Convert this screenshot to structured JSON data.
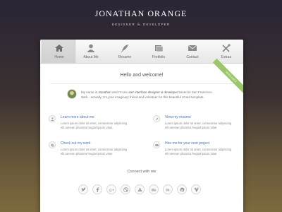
{
  "header": {
    "title": "JONATHAN ORANGE",
    "role1": "DESIGNER",
    "amp": "&",
    "role2": "DEVELOPER"
  },
  "nav": {
    "tabs": [
      {
        "label": "Home",
        "icon": "home-icon",
        "active": true
      },
      {
        "label": "About Me",
        "icon": "user-icon"
      },
      {
        "label": "Resume",
        "icon": "feather-icon"
      },
      {
        "label": "Portfolio",
        "icon": "portfolio-icon"
      },
      {
        "label": "Contact",
        "icon": "envelope-icon"
      },
      {
        "label": "Extras",
        "icon": "tools-icon"
      }
    ]
  },
  "ribbon": {
    "label": "AVAILABLE"
  },
  "welcome": {
    "title": "Hello and welcome!"
  },
  "intro": {
    "p1": "My name is",
    "name": "Jonathan",
    "p2": "and I'm an",
    "role": "user interface designer & developer",
    "p3": "based in San Francisco.",
    "line2": "Well... actually, I'm your imaginary friend and volunteer for this beautiful vCard template."
  },
  "features": [
    {
      "title": "Learn more about me",
      "text": "Lorem ipsum dolor sit amet, consectetur adipiscing elit aenean pharetra feugiat ipsum vitae.",
      "icon": "user-icon"
    },
    {
      "title": "View my resume",
      "text": "Lorem ipsum dolor sit amet, consectetur adipiscing elit aenean pharetra feugiat ipsum vitae.",
      "icon": "feather-icon"
    },
    {
      "title": "Check out my work",
      "text": "Lorem ipsum dolor sit amet, consectetur adipiscing elit aenean pharetra feugiat ipsum vitae.",
      "icon": "portfolio-icon"
    },
    {
      "title": "Hire me for your next project",
      "text": "Lorem ipsum dolor sit amet, consectetur adipiscing elit aenean pharetra feugiat ipsum vitae.",
      "icon": "envelope-icon"
    }
  ],
  "connect": {
    "title": "Connect with me"
  },
  "social": [
    {
      "name": "twitter"
    },
    {
      "name": "facebook"
    },
    {
      "name": "google-plus"
    },
    {
      "name": "dribbble"
    },
    {
      "name": "forrst"
    },
    {
      "name": "behance"
    },
    {
      "name": "linkedin"
    },
    {
      "name": "pinterest"
    },
    {
      "name": "vimeo"
    }
  ],
  "colors": {
    "accent": "#4a76b0",
    "ribbon": "#9bc76a"
  }
}
